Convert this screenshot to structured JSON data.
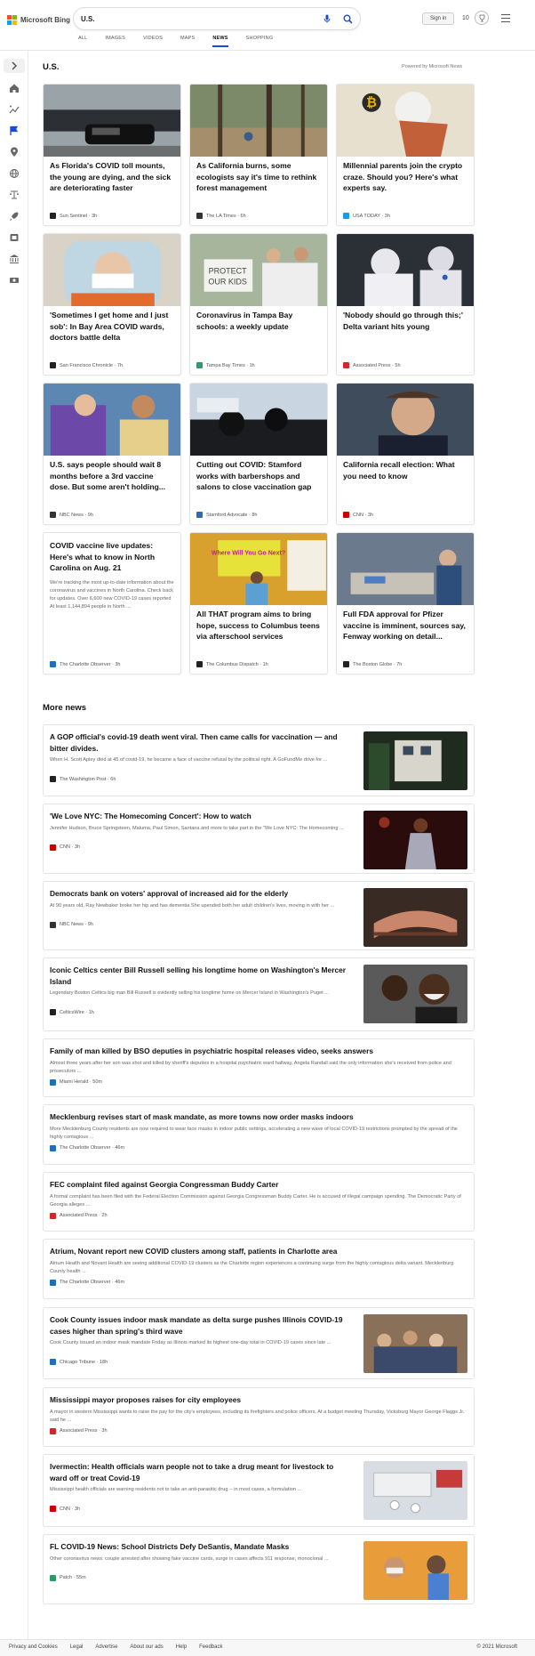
{
  "header": {
    "brand": "Microsoft Bing",
    "query": "U.S.",
    "signin": "Sign in",
    "reward_count": "10",
    "colors": {
      "accent": "#174ae4",
      "ms_red": "#f25022",
      "ms_green": "#7fba00",
      "ms_blue": "#00a4ef",
      "ms_yellow": "#ffb900"
    }
  },
  "scopes": [
    "ALL",
    "IMAGES",
    "VIDEOS",
    "MAPS",
    "NEWS",
    "SHOPPING"
  ],
  "active_scope": "NEWS",
  "sidebar": [
    "chevron-right-icon",
    "home-icon",
    "trending-icon",
    "flag-icon",
    "location-pin-icon",
    "globe-icon",
    "scale-icon",
    "rocket-icon",
    "film-icon",
    "bank-icon",
    "money-icon"
  ],
  "section": {
    "title": "U.S.",
    "powered": "Powered by Microsoft News"
  },
  "cards": [
    {
      "title": "As Florida's COVID toll mounts, the young are dying, and the sick are deteriorating faster",
      "source": "Sun Sentinel",
      "age": "3h",
      "fav": "#222",
      "img": "funeral"
    },
    {
      "title": "As California burns, some ecologists say it's time to rethink forest management",
      "source": "The LA Times",
      "age": "6h",
      "fav": "#333",
      "img": "forest"
    },
    {
      "title": "Millennial parents join the crypto craze. Should you? Here's what experts say.",
      "source": "USA TODAY",
      "age": "3h",
      "fav": "#1a9be6",
      "img": "crypto"
    },
    {
      "title": "'Sometimes I get home and I just sob': In Bay Area COVID wards, doctors battle delta",
      "source": "San Francisco Chronicle",
      "age": "7h",
      "fav": "#222",
      "img": "doctor"
    },
    {
      "title": "Coronavirus in Tampa Bay schools: a weekly update",
      "source": "Tampa Bay Times",
      "age": "1h",
      "fav": "#2b9b6a",
      "img": "protest"
    },
    {
      "title": "'Nobody should go through this;' Delta variant hits young",
      "source": "Associated Press",
      "age": "5h",
      "fav": "#d3262f",
      "img": "hazmat"
    },
    {
      "title": "U.S. says people should wait 8 months before a 3rd vaccine dose. But some aren't holding...",
      "source": "NBC News",
      "age": "9h",
      "fav": "#333",
      "img": "vaccine"
    },
    {
      "title": "Cutting out COVID: Stamford works with barbershops and salons to close vaccination gap",
      "source": "Stamford Advocate",
      "age": "8h",
      "fav": "#2a6bb5",
      "img": "barber"
    },
    {
      "title": "California recall election: What you need to know",
      "source": "CNN",
      "age": "3h",
      "fav": "#cc0000",
      "img": "newsom"
    },
    {
      "title": "COVID vaccine live updates: Here's what to know in North Carolina on Aug. 21",
      "source": "The Charlotte Observer",
      "age": "3h",
      "fav": "#1d6fb8",
      "img": "",
      "summary": "We're tracking the most up-to-date information about the coronavirus and vaccines in North Carolina. Check back for updates. Over 6,600 new COVID-19 cases reported At least 1,144,894 people in North ..."
    },
    {
      "title": "All THAT program aims to bring hope, success to Columbus teens via afterschool services",
      "source": "The Columbus Dispatch",
      "age": "1h",
      "fav": "#222",
      "img": "classroom"
    },
    {
      "title": "Full FDA approval for Pfizer vaccine is imminent, sources say, Fenway working on detail...",
      "source": "The Boston Globe",
      "age": "7h",
      "fav": "#222",
      "img": "clinic"
    }
  ],
  "more_news_title": "More news",
  "more_news": [
    {
      "title": "A GOP official's covid-19 death went viral. Then came calls for vaccination — and bitter divides.",
      "summary": "When H. Scott Apley died at 45 of covid-19, he became a face of vaccine refusal by the political right. A GoFundMe drive for ...",
      "source": "The Washington Post",
      "age": "6h",
      "fav": "#222",
      "thumb": "house"
    },
    {
      "title": "'We Love NYC: The Homecoming Concert': How to watch",
      "summary": "Jennifer Hudson, Bruce Springsteen, Maluma, Paul Simon, Santana and more to take part in the \"We Love NYC: The Homecoming ...",
      "source": "CNN",
      "age": "3h",
      "fav": "#cc0000",
      "thumb": "singer"
    },
    {
      "title": "Democrats bank on voters' approval of increased aid for the elderly",
      "summary": "At 90 years old, Ray Newbaker broke her hip and has dementia She upended both her adult children's lives, moving in with her ...",
      "source": "NBC News",
      "age": "9h",
      "fav": "#333",
      "thumb": "hands"
    },
    {
      "title": "Iconic Celtics center Bill Russell selling his longtime home on Washington's Mercer Island",
      "summary": "Legendary Boston Celtics big man Bill Russell is evidently selling his longtime home on Mercer Island in Washington's Puget ...",
      "source": "CelticsWire",
      "age": "1h",
      "fav": "#222",
      "thumb": "russell"
    },
    {
      "title": "Family of man killed by BSO deputies in psychiatric hospital releases video, seeks answers",
      "summary": "Almost three years after her son was shot and killed by sheriff's deputies in a hospital psychiatric ward hallway, Angela Randall said the only information she's received from police and prosecutors ...",
      "source": "Miami Herald",
      "age": "50m",
      "fav": "#1d6fb8",
      "thumb": ""
    },
    {
      "title": "Mecklenburg revises start of mask mandate, as more towns now order masks indoors",
      "summary": "More Mecklenburg County residents are now required to wear face masks in indoor public settings, accelerating a new wave of local COVID-19 restrictions prompted by the spread of the highly contagious ...",
      "source": "The Charlotte Observer",
      "age": "46m",
      "fav": "#1d6fb8",
      "thumb": ""
    },
    {
      "title": "FEC complaint filed against Georgia Congressman Buddy Carter",
      "summary": "A formal complaint has been filed with the Federal Election Commission against Georgia Congressman Buddy Carter. He is accused of illegal campaign spending. The Democratic Party of Georgia alleges ...",
      "source": "Associated Press",
      "age": "2h",
      "fav": "#d3262f",
      "thumb": ""
    },
    {
      "title": "Atrium, Novant report new COVID clusters among staff, patients in Charlotte area",
      "summary": "Atrium Health and Novant Health are seeing additional COVID-19 clusters as the Charlotte region experiences a continuing surge from the highly contagious delta variant. Mecklenburg County health ...",
      "source": "The Charlotte Observer",
      "age": "46m",
      "fav": "#1d6fb8",
      "thumb": ""
    },
    {
      "title": "Cook County issues indoor mask mandate as delta surge pushes Illinois COVID-19 cases higher than spring's third wave",
      "summary": "Cook County issued an indoor mask mandate Friday as Illinois marked its highest one-day total in COVID-19 cases since late ...",
      "source": "Chicago Tribune",
      "age": "18h",
      "fav": "#1d6fb8",
      "thumb": "crowd"
    },
    {
      "title": "Mississippi mayor proposes raises for city employees",
      "summary": "A mayor in western Mississippi wants to raise the pay for the city's employees, including its firefighters and police officers. At a budget meeting Thursday, Vicksburg Mayor George Flaggs Jr. said he ...",
      "source": "Associated Press",
      "age": "3h",
      "fav": "#d3262f",
      "thumb": ""
    },
    {
      "title": "Ivermectin: Health officials warn people not to take a drug meant for livestock to ward off or treat Covid-19",
      "summary": "Mississippi health officials are warning residents not to take an anti-parasitic drug -- in most cases, a formulation ...",
      "source": "CNN",
      "age": "3h",
      "fav": "#cc0000",
      "thumb": "pills"
    },
    {
      "title": "FL COVID-19 News: School Districts Defy DeSantis, Mandate Masks",
      "summary": "Other coronavirus news: couple arrested after showing fake vaccine cards, surge in cases affects 911 response, monoclonal ...",
      "source": "Patch",
      "age": "55m",
      "fav": "#2b9b6a",
      "thumb": "kids"
    }
  ],
  "footer": {
    "links": [
      "Privacy and Cookies",
      "Legal",
      "Advertise",
      "About our ads",
      "Help",
      "Feedback"
    ],
    "copyright": "© 2021 Microsoft"
  }
}
